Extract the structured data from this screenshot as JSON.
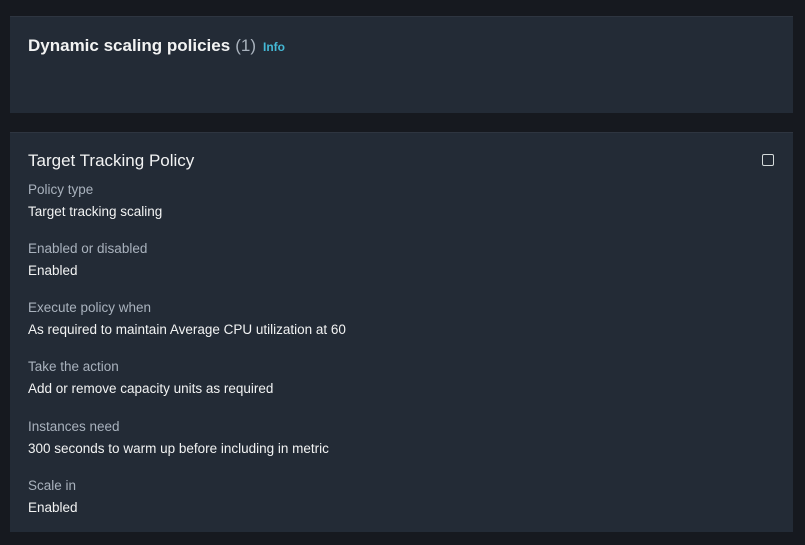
{
  "header": {
    "title": "Dynamic scaling policies",
    "count": "(1)",
    "info_label": "Info"
  },
  "policy": {
    "title": "Target Tracking Policy",
    "fields": [
      {
        "label": "Policy type",
        "value": "Target tracking scaling"
      },
      {
        "label": "Enabled or disabled",
        "value": "Enabled"
      },
      {
        "label": "Execute policy when",
        "value": "As required to maintain Average CPU utilization at 60"
      },
      {
        "label": "Take the action",
        "value": "Add or remove capacity units as required"
      },
      {
        "label": "Instances need",
        "value": "300 seconds to warm up before including in metric"
      },
      {
        "label": "Scale in",
        "value": "Enabled"
      }
    ]
  },
  "colors": {
    "background": "#16191f",
    "panel": "#232b36",
    "link": "#44b9d6",
    "text_primary": "#f2f3f3",
    "text_secondary": "#a9b2bd"
  }
}
